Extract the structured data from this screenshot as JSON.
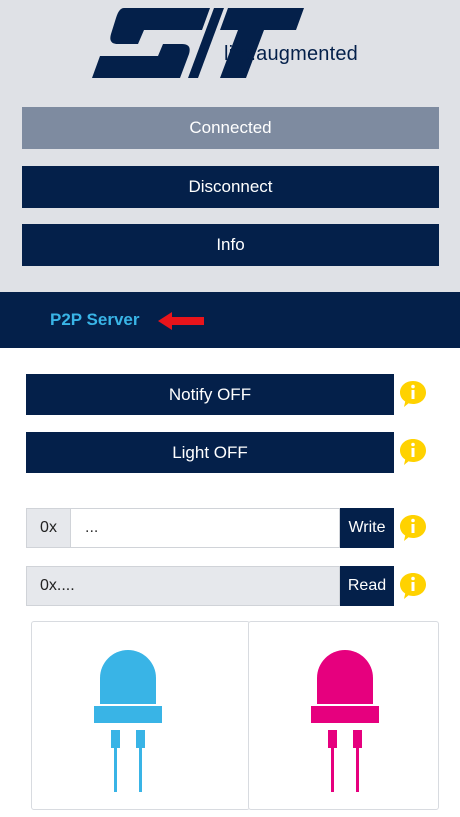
{
  "header": {
    "logo_text": "ST",
    "tagline": "life.augmented",
    "buttons": {
      "connected": "Connected",
      "disconnect": "Disconnect",
      "info": "Info"
    }
  },
  "section": {
    "title": "P2P Server"
  },
  "actions": {
    "notify_label": "Notify OFF",
    "light_label": "Light OFF"
  },
  "write": {
    "prefix": "0x",
    "placeholder": "...",
    "button": "Write"
  },
  "read": {
    "value": "0x....",
    "button": "Read"
  },
  "leds": [
    {
      "name": "led-blue",
      "color": "#39b4e6"
    },
    {
      "name": "led-pink",
      "color": "#e6007e"
    }
  ],
  "colors": {
    "navy": "#04204a",
    "header_bg": "#dfe1e6",
    "connected_bg": "#7e8ba0",
    "accent_blue": "#39b4e6",
    "info_yellow": "#ffd200",
    "arrow_red": "#e8141b"
  },
  "icons": {
    "info": "info-bubble-icon",
    "arrow": "arrow-left-icon"
  }
}
